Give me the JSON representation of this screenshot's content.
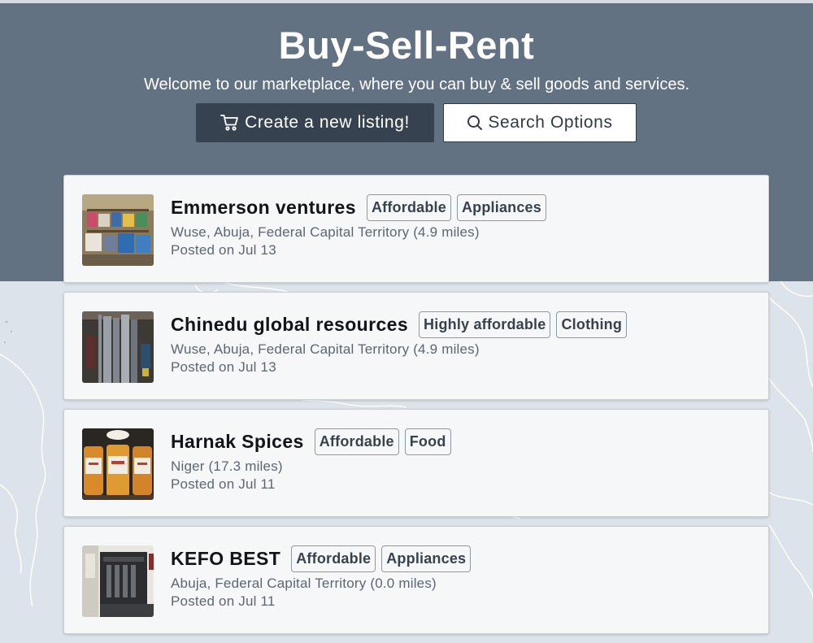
{
  "header": {
    "title": "Buy-Sell-Rent",
    "subtitle": "Welcome to our marketplace, where you can buy & sell goods and services.",
    "create_button": {
      "label": "Create a new listing!",
      "icon": "cart-icon"
    },
    "search_button": {
      "label": "Search Options",
      "icon": "search-icon"
    }
  },
  "colors": {
    "hero_bg": "#637282",
    "primary_button": "#36424f",
    "card_bg": "#f6f7f9",
    "map_bg": "#dde3ea"
  },
  "listings": [
    {
      "name": "Emmerson ventures",
      "tags": [
        "Affordable",
        "Appliances"
      ],
      "location": "Wuse, Abuja, Federal Capital Territory (4.9 miles)",
      "posted": "Posted on Jul 13",
      "thumbnail": "shelf-goods-photo"
    },
    {
      "name": "Chinedu global resources",
      "tags": [
        "Highly affordable",
        "Clothing"
      ],
      "location": "Wuse, Abuja, Federal Capital Territory (4.9 miles)",
      "posted": "Posted on Jul 13",
      "thumbnail": "clothing-rack-photo"
    },
    {
      "name": "Harnak Spices",
      "tags": [
        "Affordable",
        "Food"
      ],
      "location": "Niger (17.3 miles)",
      "posted": "Posted on Jul 11",
      "thumbnail": "spice-jars-photo"
    },
    {
      "name": "KEFO BEST",
      "tags": [
        "Affordable",
        "Appliances"
      ],
      "location": "Abuja, Federal Capital Territory (0.0 miles)",
      "posted": "Posted on Jul 11",
      "thumbnail": "kitchen-appliance-photo"
    }
  ]
}
